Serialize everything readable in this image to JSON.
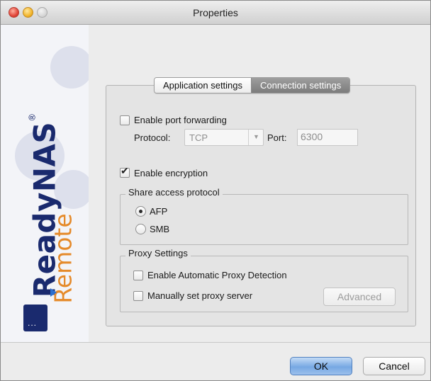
{
  "window": {
    "title": "Properties"
  },
  "sidebar": {
    "brand_name": "ReadyNAS",
    "brand_mark": "®",
    "brand_sub": "Remote",
    "device_dots": "..."
  },
  "tabs": [
    {
      "label": "Application settings",
      "selected": false
    },
    {
      "label": "Connection settings",
      "selected": true
    }
  ],
  "port_forwarding": {
    "label": "Enable port forwarding",
    "checked": false,
    "protocol_label": "Protocol:",
    "protocol_value": "TCP",
    "port_label": "Port:",
    "port_value": "6300"
  },
  "encryption": {
    "label": "Enable encryption",
    "checked": true
  },
  "share_access": {
    "title": "Share access protocol",
    "options": [
      {
        "label": "AFP",
        "selected": true
      },
      {
        "label": "SMB",
        "selected": false
      }
    ]
  },
  "proxy": {
    "title": "Proxy Settings",
    "auto_detect_label": "Enable Automatic Proxy Detection",
    "manual_label": "Manually set proxy server",
    "advanced_label": "Advanced"
  },
  "footer": {
    "ok_label": "OK",
    "cancel_label": "Cancel"
  },
  "colors": {
    "brand_blue": "#1a2a6e",
    "brand_orange": "#e58a2a",
    "selected_tab": "#8a8a8a",
    "ok_button": "#77a8e3"
  }
}
